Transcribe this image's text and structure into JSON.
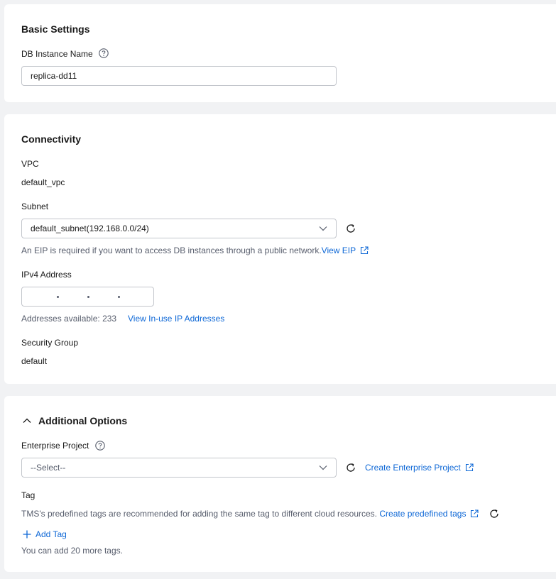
{
  "basic": {
    "title": "Basic Settings",
    "instance_name_label": "DB Instance Name",
    "instance_name_value": "replica-dd11"
  },
  "connectivity": {
    "title": "Connectivity",
    "vpc_label": "VPC",
    "vpc_value": "default_vpc",
    "subnet_label": "Subnet",
    "subnet_value": "default_subnet(192.168.0.0/24)",
    "eip_hint": "An EIP is required if you want to access DB instances through a public network.",
    "view_eip_link": "View EIP",
    "ipv4_label": "IPv4 Address",
    "addresses_available": "Addresses available: 233",
    "view_inuse_link": "View In-use IP Addresses",
    "security_group_label": "Security Group",
    "security_group_value": "default"
  },
  "options": {
    "title": "Additional Options",
    "enterprise_project_label": "Enterprise Project",
    "enterprise_project_placeholder": "--Select--",
    "create_enterprise_project_link": "Create Enterprise Project",
    "tag_label": "Tag",
    "tag_hint": "TMS's predefined tags are recommended for adding the same tag to different cloud resources.",
    "create_predefined_tags_link": "Create predefined tags",
    "add_tag_label": "Add Tag",
    "tags_remaining": "You can add 20 more tags."
  },
  "colors": {
    "link": "#0d67d6",
    "background": "#f1f2f4",
    "card": "#ffffff",
    "border": "#c3c6cc"
  },
  "icons": [
    "help-icon",
    "chevron-down-icon",
    "refresh-icon",
    "external-link-icon",
    "chevron-up-icon",
    "plus-icon"
  ]
}
